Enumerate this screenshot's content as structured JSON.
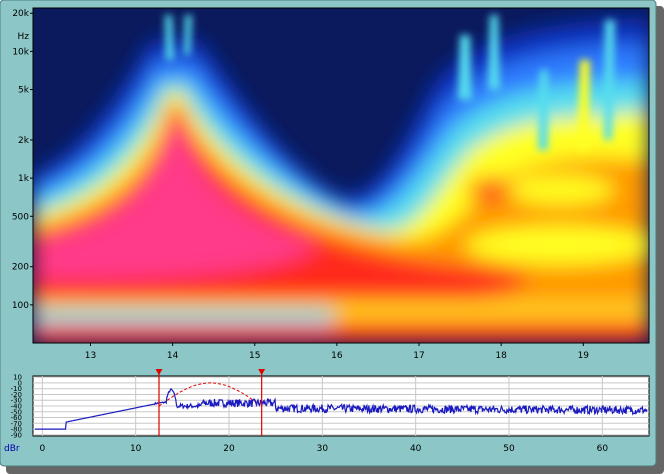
{
  "window": {
    "bg_color": "#8cc6c6",
    "shadow_color": "#666666"
  },
  "chart_data": [
    {
      "type": "heatmap",
      "title": "",
      "y_unit": "Hz",
      "y_ticks": [
        "20k",
        "10k",
        "5k",
        "2k",
        "1k",
        "500",
        "200",
        "100"
      ],
      "x_ticks": [
        "13",
        "14",
        "15",
        "16",
        "17",
        "18",
        "19"
      ],
      "x_range": [
        12.3,
        19.8
      ],
      "y_scale": "log",
      "y_range": [
        50,
        22000
      ],
      "colormap": [
        "#0a1a5c",
        "#1030c0",
        "#2f7cff",
        "#55ddee",
        "#ffff22",
        "#ff9900",
        "#ff2a1a",
        "#ff3a8a"
      ]
    },
    {
      "type": "line",
      "ylabel": "dBr",
      "y_ticks": [
        "10",
        "0",
        "-10",
        "-20",
        "-30",
        "-40",
        "-50",
        "-60",
        "-70",
        "-80",
        "-90"
      ],
      "x_ticks": [
        "0",
        "10",
        "20",
        "30",
        "40",
        "50",
        "60"
      ],
      "x_range": [
        -1,
        65
      ],
      "y_range": [
        -92,
        12
      ],
      "series_color": "#1a1ac0",
      "markers": [
        12.5,
        23.5
      ],
      "marker_color": "#e00000",
      "envelope": {
        "start": 12.5,
        "end": 23.5,
        "peak": 0
      }
    }
  ]
}
